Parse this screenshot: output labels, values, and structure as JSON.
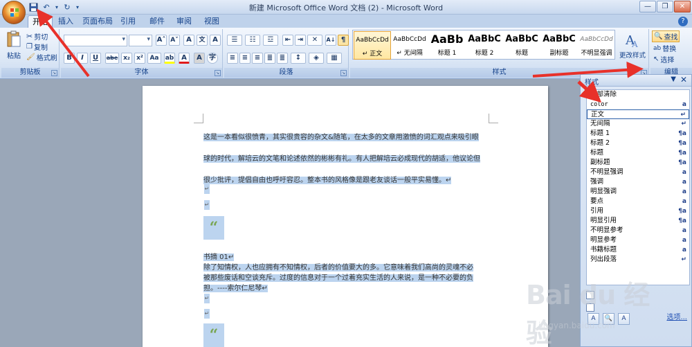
{
  "window": {
    "title": "新建 Microsoft Office Word 文档 (2) - Microsoft Word",
    "controls": [
      "—",
      "❐",
      "✕"
    ]
  },
  "tabs": [
    "开始",
    "插入",
    "页面布局",
    "引用",
    "邮件",
    "审阅",
    "视图"
  ],
  "active_tab": "开始",
  "ribbon": {
    "clipboard": {
      "label": "剪贴板",
      "paste": "粘贴",
      "cut": "剪切",
      "copy": "复制",
      "format_painter": "格式刷"
    },
    "font": {
      "label": "字体",
      "font_name": "",
      "font_size": "",
      "buttons": [
        "B",
        "I",
        "U",
        "abe",
        "x₂",
        "x²",
        "Aa"
      ]
    },
    "paragraph": {
      "label": "段落"
    },
    "styles": {
      "label": "样式",
      "change_styles": "更改样式",
      "gallery": [
        {
          "sample": "AaBbCcDd",
          "name": "↵ 正文",
          "active": true
        },
        {
          "sample": "AaBbCcDd",
          "name": "↵ 无间隔",
          "active": false
        },
        {
          "sample": "AaBb",
          "name": "标题 1",
          "active": false
        },
        {
          "sample": "AaBbC",
          "name": "标题 2",
          "active": false
        },
        {
          "sample": "AaBbC",
          "name": "标题",
          "active": false
        },
        {
          "sample": "AaBbC",
          "name": "副标题",
          "active": false
        },
        {
          "sample": "AaBbCcDd",
          "name": "不明显强调",
          "active": false
        }
      ]
    },
    "editing": {
      "label": "编辑",
      "find": "查找",
      "replace": "替换",
      "select": "选择"
    }
  },
  "document": {
    "paragraphs": [
      "这是一本看似很愤青，其实很贵容的杂文&随笔，在太多的文章用激愤的词汇观点来吸引眼",
      "球的时代，解培云的文笔和论述依然的彬彬有礼。有人把解培云必成现代的胡适，他议论但",
      "很少批评，提倡自由也呼吁容忍。整本书的风格像是跟老友谈话一般平实易懂。↵"
    ],
    "quote_mark": "“",
    "heading": "书摘 01↵",
    "excerpt": [
      "除了知情权，人也应拥有不知情权，后者的价值要大的多。它意味着我们高尚的灵魂不必",
      "被那些废话和空谈充斥。过度的信息对于一个过着充实生活的人来说，是一种不必要的负",
      "担。----索尔仁尼琴↵"
    ],
    "return_mark": "↵"
  },
  "styles_pane": {
    "title": "样式",
    "items": [
      {
        "name": "全部清除",
        "sym": ""
      },
      {
        "name": "color",
        "sym": "a"
      },
      {
        "name": "正文",
        "sym": "↵",
        "selected": true
      },
      {
        "name": "无间隔",
        "sym": "↵"
      },
      {
        "name": "标题 1",
        "sym": "¶a"
      },
      {
        "name": "标题 2",
        "sym": "¶a"
      },
      {
        "name": "标题",
        "sym": "¶a"
      },
      {
        "name": "副标题",
        "sym": "¶a"
      },
      {
        "name": "不明显强调",
        "sym": "a"
      },
      {
        "name": "强调",
        "sym": "a"
      },
      {
        "name": "明显强调",
        "sym": "a"
      },
      {
        "name": "要点",
        "sym": "a"
      },
      {
        "name": "引用",
        "sym": "¶a"
      },
      {
        "name": "明显引用",
        "sym": "¶a"
      },
      {
        "name": "不明显参考",
        "sym": "a"
      },
      {
        "name": "明显参考",
        "sym": "a"
      },
      {
        "name": "书籍标题",
        "sym": "a"
      },
      {
        "name": "列出段落",
        "sym": "↵"
      }
    ],
    "options": "选项..."
  },
  "watermark": {
    "logo": "Bai du 经验",
    "url": "jingyan.baidu.com"
  },
  "colors": {
    "annotation": "#e8312a",
    "selection": "#bcd4ef",
    "ribbon": "#dde8f6"
  }
}
